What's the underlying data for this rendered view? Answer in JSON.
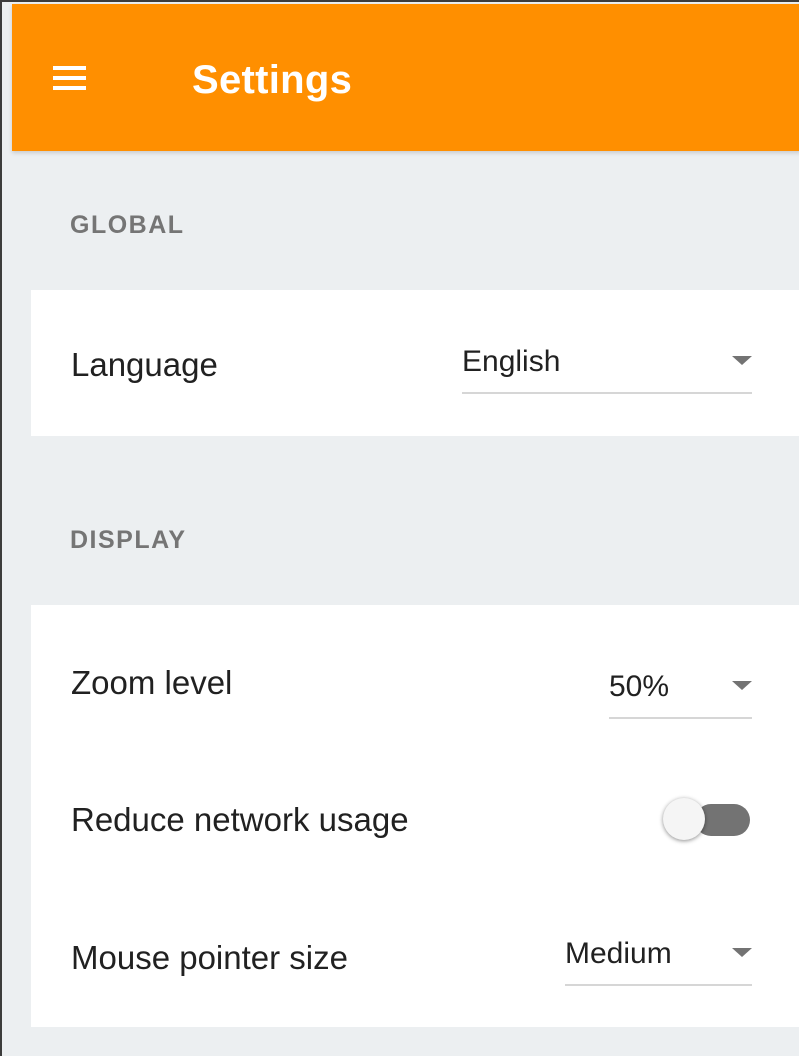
{
  "app_bar": {
    "title": "Settings",
    "menu_icon": "hamburger-menu-icon",
    "color": "#ff8f00"
  },
  "sections": {
    "global": {
      "header": "GLOBAL",
      "language": {
        "label": "Language",
        "value": "English"
      }
    },
    "display": {
      "header": "DISPLAY",
      "zoom_level": {
        "label": "Zoom level",
        "value": "50%"
      },
      "reduce_network_usage": {
        "label": "Reduce network usage",
        "enabled": false
      },
      "mouse_pointer_size": {
        "label": "Mouse pointer size",
        "value": "Medium"
      }
    }
  },
  "colors": {
    "background": "#eceff1",
    "card": "#ffffff",
    "accent": "#ff8f00",
    "section_header": "#757575",
    "text": "#212121"
  }
}
